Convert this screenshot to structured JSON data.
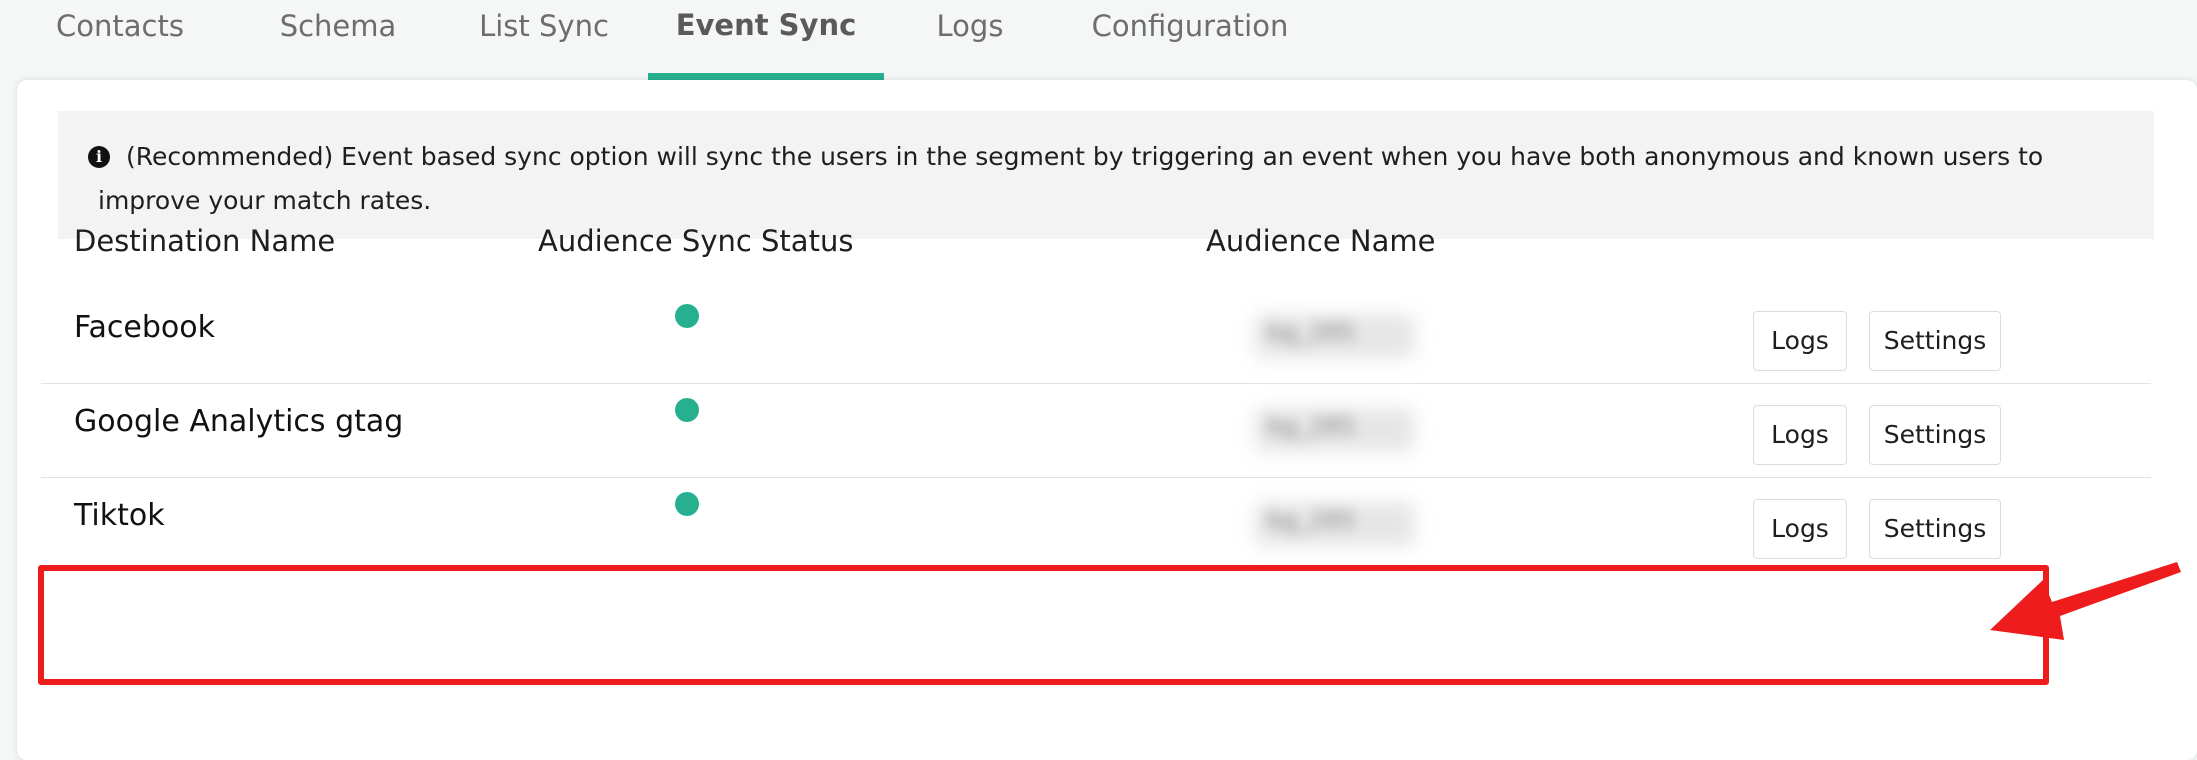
{
  "tabs": [
    {
      "label": "Contacts"
    },
    {
      "label": "Schema"
    },
    {
      "label": "List Sync"
    },
    {
      "label": "Event Sync"
    },
    {
      "label": "Logs"
    },
    {
      "label": "Configuration"
    }
  ],
  "active_tab": "Event Sync",
  "info_box": {
    "icon": "info-icon",
    "text": "(Recommended) Event based sync option will sync the users in the segment by triggering an event when you have both anonymous and known users to improve your match rates."
  },
  "table": {
    "headers": {
      "destination_name": "Destination Name",
      "audience_sync_status": "Audience Sync Status",
      "audience_name": "Audience Name"
    },
    "rows": [
      {
        "destination": "Facebook",
        "status_color": "#26b08f",
        "audience_name": "bg_285",
        "logs_label": "Logs",
        "settings_label": "Settings"
      },
      {
        "destination": "Google Analytics gtag",
        "status_color": "#26b08f",
        "audience_name": "bg_285",
        "logs_label": "Logs",
        "settings_label": "Settings"
      },
      {
        "destination": "Tiktok",
        "status_color": "#26b08f",
        "audience_name": "bg_285",
        "logs_label": "Logs",
        "settings_label": "Settings"
      }
    ]
  },
  "colors": {
    "accent": "#26b08f",
    "annotation": "#ee1c1c"
  }
}
